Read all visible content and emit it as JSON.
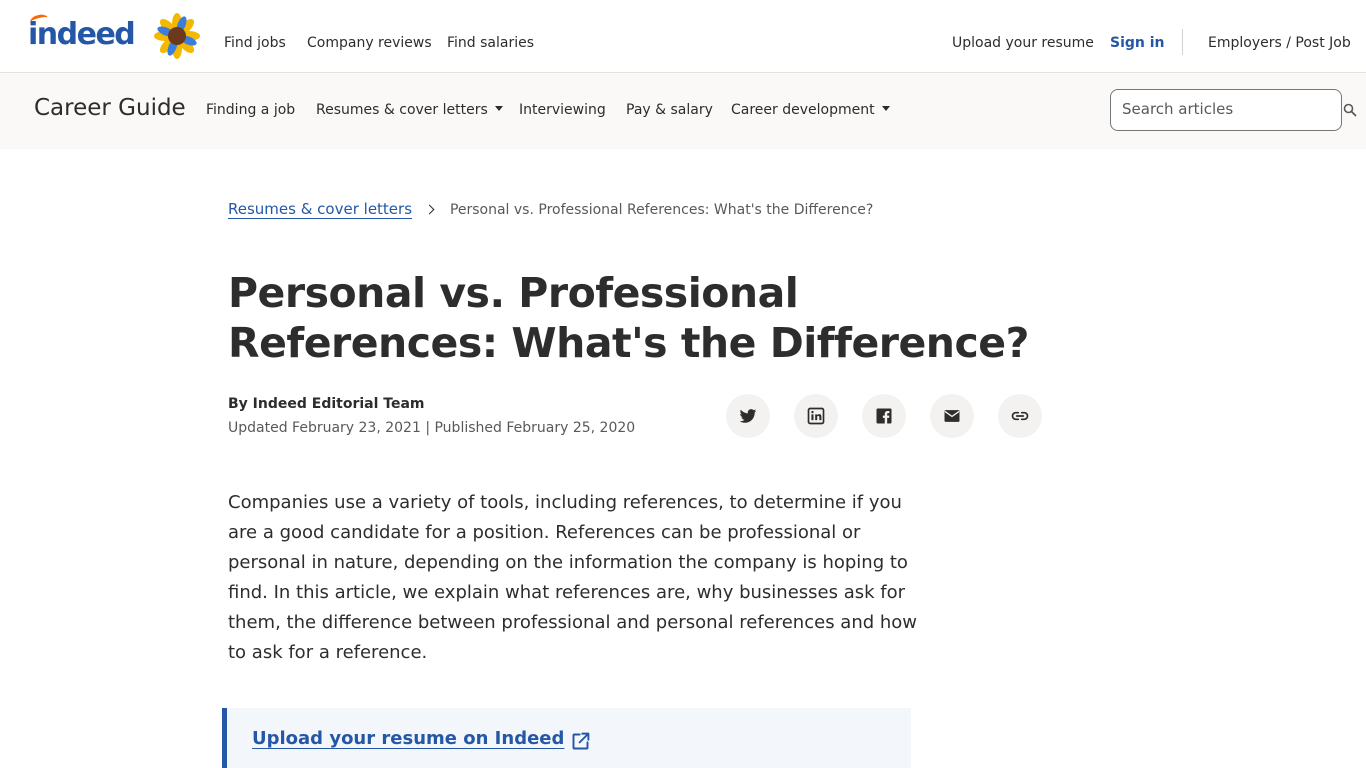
{
  "header": {
    "logo_text": "indeed",
    "nav": [
      "Find jobs",
      "Company reviews",
      "Find salaries"
    ],
    "upload_resume": "Upload your resume",
    "sign_in": "Sign in",
    "employers": "Employers / Post Job"
  },
  "guide": {
    "title": "Career Guide",
    "nav": [
      {
        "label": "Finding a job",
        "dropdown": false
      },
      {
        "label": "Resumes & cover letters",
        "dropdown": true
      },
      {
        "label": "Interviewing",
        "dropdown": false
      },
      {
        "label": "Pay & salary",
        "dropdown": false
      },
      {
        "label": "Career development",
        "dropdown": true
      }
    ],
    "search_placeholder": "Search articles"
  },
  "breadcrumb": {
    "parent": "Resumes & cover letters",
    "current": "Personal vs. Professional References: What's the Difference?"
  },
  "article": {
    "title": "Personal vs. Professional References: What's the Difference?",
    "byline": "By Indeed Editorial Team",
    "dates": "Updated February 23, 2021 | Published February 25, 2020",
    "share_icons": [
      "twitter-icon",
      "linkedin-icon",
      "facebook-icon",
      "email-icon",
      "link-icon"
    ],
    "intro": "Companies use a variety of tools, including references, to determine if you are a good candidate for a position. References can be professional or personal in nature, depending on the information the company is hoping to find. In this article, we explain what references are, why businesses ask for them, the difference between professional and personal references and how to ask for a reference.",
    "callout_link": "Upload your resume on Indeed"
  },
  "colors": {
    "brand_blue": "#2557a7",
    "accent_orange": "#ff6600",
    "text": "#2d2d2d"
  }
}
